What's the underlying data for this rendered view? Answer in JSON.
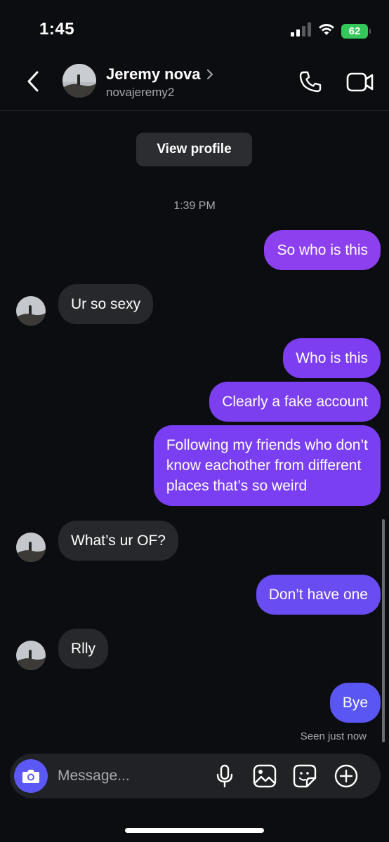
{
  "status_bar": {
    "time": "1:45",
    "battery": "62"
  },
  "header": {
    "contact_name": "Jeremy nova",
    "username": "novajeremy2"
  },
  "view_profile_label": "View profile",
  "timestamp": "1:39 PM",
  "messages": [
    {
      "direction": "outgoing",
      "text": "So who is this",
      "color": "#8c40ee"
    },
    {
      "direction": "incoming",
      "text": "Ur so sexy"
    },
    {
      "direction": "outgoing",
      "text": "Who is this",
      "color": "#7c3ef0"
    },
    {
      "direction": "outgoing",
      "text": "Clearly a fake account",
      "color": "#7b3ff0"
    },
    {
      "direction": "outgoing",
      "lines": [
        "Following my friends who don’t",
        "know eachother from different",
        "places that’s so weird"
      ],
      "color": "#7a3ff2"
    },
    {
      "direction": "incoming",
      "text": "What’s ur OF?"
    },
    {
      "direction": "outgoing",
      "text": "Don’t have one",
      "color": "#6a4cf3"
    },
    {
      "direction": "incoming",
      "text": "Rlly"
    },
    {
      "direction": "outgoing",
      "text": "Bye",
      "color": "#5a56f4"
    }
  ],
  "seen_label": "Seen just now",
  "composer": {
    "placeholder": "Message...",
    "icons": [
      "camera-icon",
      "microphone-icon",
      "image-icon",
      "sticker-icon",
      "plus-circle-icon"
    ]
  },
  "colors": {
    "background": "#0c0d10",
    "incoming_bubble": "#26282c",
    "accent_camera": "#5b58f5",
    "battery": "#34c759"
  }
}
